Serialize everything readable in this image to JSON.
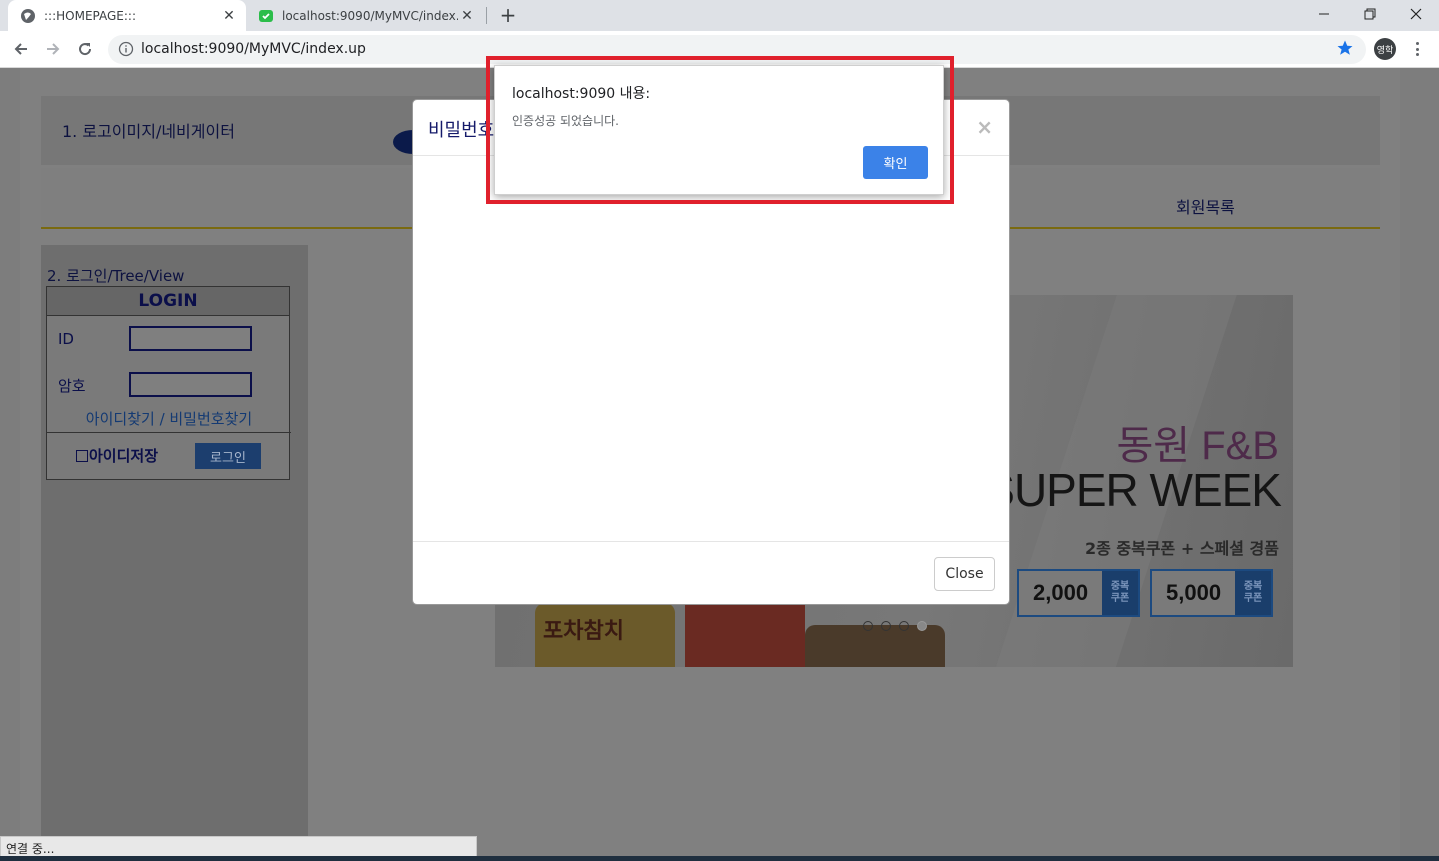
{
  "browser": {
    "tabs": [
      {
        "title": ":::HOMEPAGE:::",
        "icon": "globe-icon"
      },
      {
        "title": "localhost:9090/MyMVC/index.up",
        "icon": "app-favicon"
      }
    ],
    "url": "localhost:9090/MyMVC/index.up",
    "profile_label": "영학"
  },
  "page": {
    "header_label": "1. 로고이미지/네비게이터",
    "nav_member_list": "회원목록",
    "side_label": "2. 로그인/Tree/View",
    "login": {
      "title": "LOGIN",
      "id_label": "ID",
      "pw_label": "암호",
      "find_links": "아이디찾기 / 비밀번호찾기",
      "save_id": "아이디저장",
      "login_button": "로그인"
    },
    "banner": {
      "brand": "동원 F&B",
      "headline": "SUPER WEEK",
      "sub": "2종 중복쿠폰 + 스페셜 경품",
      "coupons": [
        {
          "amount": "2,000",
          "tag": "중복\n쿠폰"
        },
        {
          "amount": "5,000",
          "tag": "중복\n쿠폰"
        }
      ],
      "product_label": "포차참치"
    }
  },
  "modal": {
    "title": "비밀번호",
    "close_label": "Close",
    "close_x": "×"
  },
  "alert": {
    "origin": "localhost:9090 내용:",
    "message": "인증성공 되었습니다.",
    "ok_label": "확인"
  },
  "status_text": "연결 중...",
  "colors": {
    "alert_highlight": "#e0202c",
    "ok_button": "#3b82e8",
    "overlay": "#7d7d7d"
  }
}
